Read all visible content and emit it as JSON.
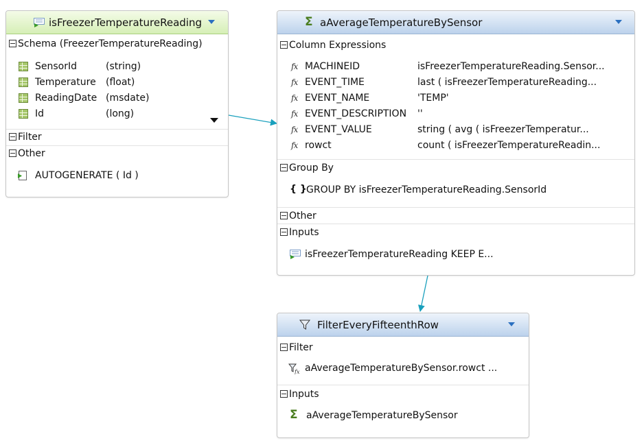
{
  "colors": {
    "connector": "#1aa0bd",
    "header_green": "#d6efb6",
    "header_blue": "#bcd2ec",
    "dropdown_arrow": "#2b70c0"
  },
  "node1": {
    "title": "isFreezerTemperatureReading",
    "icon": "stream-icon",
    "schema_header": "Schema (FreezerTemperatureReading)",
    "fields": [
      {
        "name": "SensorId",
        "type": "(string)"
      },
      {
        "name": "Temperature",
        "type": "(float)"
      },
      {
        "name": "ReadingDate",
        "type": "(msdate)"
      },
      {
        "name": "Id",
        "type": "(long)"
      }
    ],
    "filter_header": "Filter",
    "other_header": "Other",
    "other_item": "AUTOGENERATE ( Id )"
  },
  "node2": {
    "title": "aAverageTemperatureBySensor",
    "icon": "sigma-icon",
    "colexp_header": "Column Expressions",
    "columns": [
      {
        "name": "MACHINEID",
        "expr": "isFreezerTemperatureReading.Sensor..."
      },
      {
        "name": "EVENT_TIME",
        "expr": "last ( isFreezerTemperatureReading..."
      },
      {
        "name": "EVENT_NAME",
        "expr": "'TEMP'"
      },
      {
        "name": "EVENT_DESCRIPTION",
        "expr": "''"
      },
      {
        "name": "EVENT_VALUE",
        "expr": "string ( avg ( isFreezerTemperatur..."
      },
      {
        "name": "rowct",
        "expr": "count ( isFreezerTemperatureReadin..."
      }
    ],
    "groupby_header": "Group By",
    "groupby_item": "GROUP BY isFreezerTemperatureReading.SensorId",
    "other_header": "Other",
    "inputs_header": "Inputs",
    "inputs_item": "isFreezerTemperatureReading KEEP E..."
  },
  "node3": {
    "title": "FilterEveryFifteenthRow",
    "icon": "funnel-icon",
    "filter_header": "Filter",
    "filter_item": "aAverageTemperatureBySensor.rowct ...",
    "inputs_header": "Inputs",
    "inputs_item": "aAverageTemperatureBySensor"
  }
}
